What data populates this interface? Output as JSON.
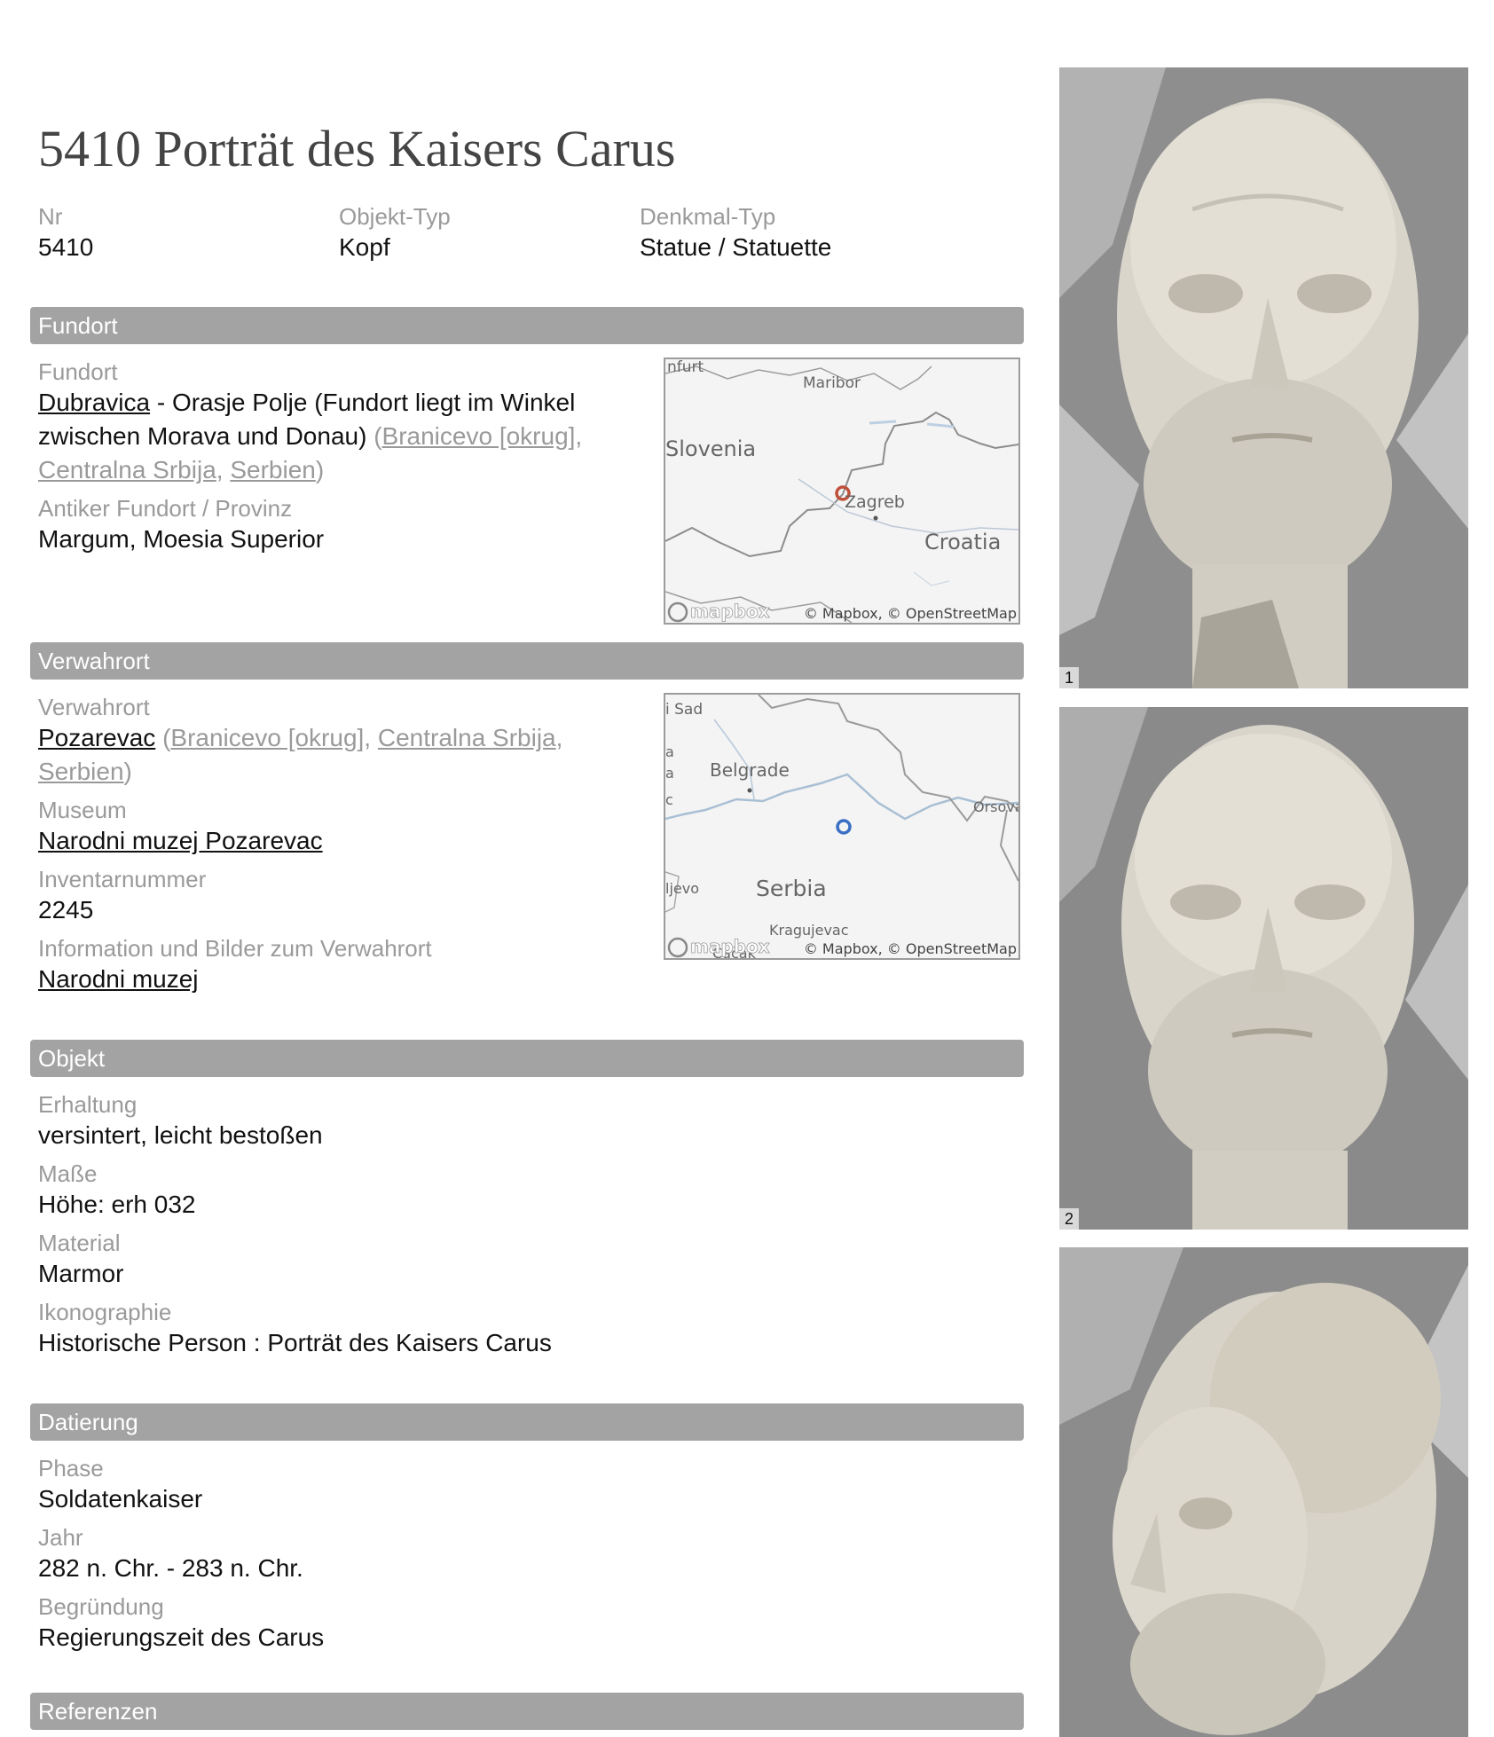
{
  "title": "5410 Porträt des Kaisers Carus",
  "summary": [
    {
      "label": "Nr",
      "value": "5410"
    },
    {
      "label": "Objekt-Typ",
      "value": "Kopf"
    },
    {
      "label": "Denkmal-Typ",
      "value": "Statue / Statuette"
    }
  ],
  "fundort": {
    "header": "Fundort",
    "label_fundort": "Fundort",
    "place_link": "Dubravica",
    "place_text": " - Orasje Polje (Fundort liegt im Winkel zwischen Morava und Donau) ",
    "region_open": "(",
    "region_links": [
      "Branicevo [okrug]",
      "Centralna Srbija",
      "Serbien"
    ],
    "region_sep": ", ",
    "region_close": ")",
    "label_antik": "Antiker Fundort / Provinz",
    "antik_value": "Margum, Moesia Superior",
    "map": {
      "labels": [
        "nfurt",
        "Maribor",
        "Slovenia",
        "Zagreb",
        "Croatia"
      ],
      "logo": "mapbox",
      "attribution": "© Mapbox, © OpenStreetMap",
      "marker_color": "#c0503a"
    }
  },
  "verwahrort": {
    "header": "Verwahrort",
    "label_verwahrort": "Verwahrort",
    "place_link": "Pozarevac",
    "region_open": " (",
    "region_links": [
      "Branicevo [okrug]",
      "Centralna Srbija",
      "Serbien"
    ],
    "region_sep": ", ",
    "region_close": ")",
    "label_museum": "Museum",
    "museum": "Narodni muzej Pozarevac",
    "label_inventar": "Inventarnummer",
    "inventar": "2245",
    "label_info": "Information und Bilder zum Verwahrort",
    "info": "Narodni muzej",
    "map": {
      "labels": [
        "i Sad",
        "a",
        "a",
        "c",
        "Belgrade",
        "Orsova",
        "ljevo",
        "Serbia",
        "Kragujevac",
        "Čačak"
      ],
      "logo": "mapbox",
      "attribution": "© Mapbox, © OpenStreetMap",
      "marker_color": "#3a6fc4"
    }
  },
  "objekt": {
    "header": "Objekt",
    "fields": [
      {
        "label": "Erhaltung",
        "value": "versintert, leicht bestoßen"
      },
      {
        "label": "Maße",
        "value": "Höhe: erh 032"
      },
      {
        "label": "Material",
        "value": "Marmor"
      },
      {
        "label": "Ikonographie",
        "value": "Historische Person : Porträt des Kaisers Carus"
      }
    ]
  },
  "datierung": {
    "header": "Datierung",
    "fields": [
      {
        "label": "Phase",
        "value": "Soldatenkaiser"
      },
      {
        "label": "Jahr",
        "value": "282 n. Chr. - 283 n. Chr."
      },
      {
        "label": "Begründung",
        "value": "Regierungszeit des Carus"
      }
    ]
  },
  "referenzen": {
    "header": "Referenzen"
  },
  "photos": [
    "1",
    "2"
  ]
}
